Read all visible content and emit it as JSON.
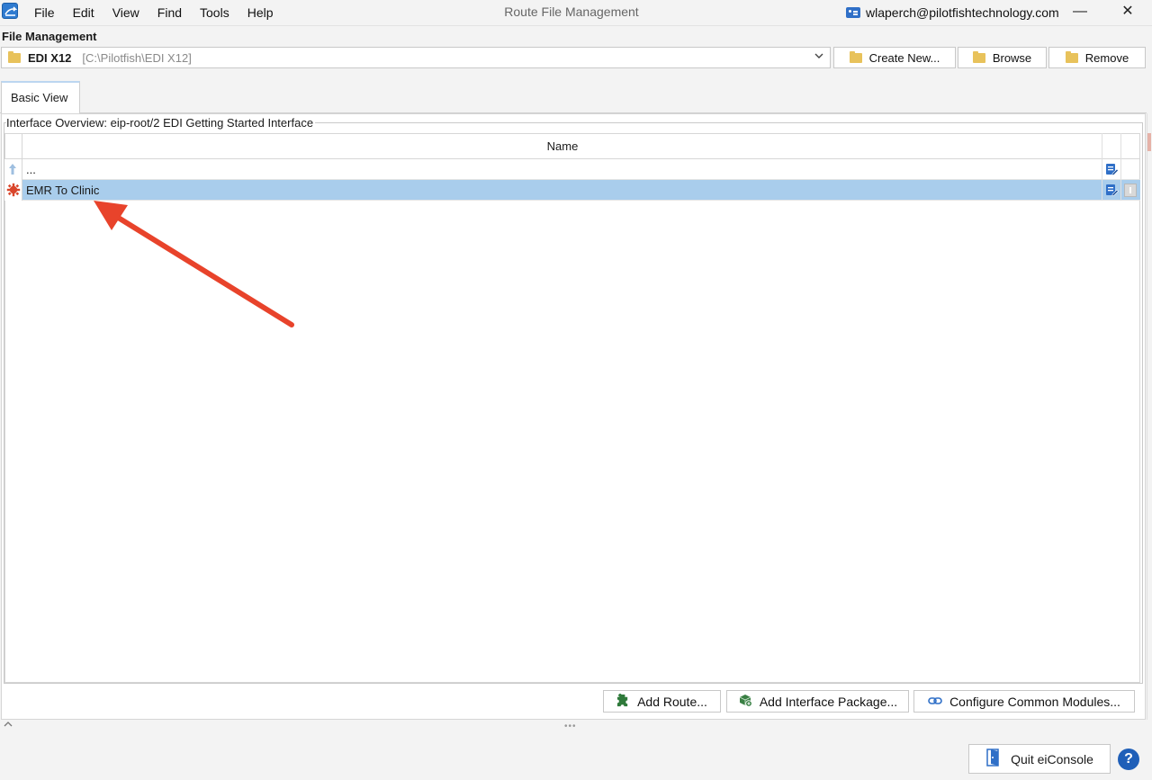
{
  "window": {
    "title": "Route File Management",
    "user": "wlaperch@pilotfishtechnology.com",
    "minimize": "—",
    "close": "✕"
  },
  "menu": [
    "File",
    "Edit",
    "View",
    "Find",
    "Tools",
    "Help"
  ],
  "file_management": {
    "label": "File Management",
    "selected_name": "EDI X12",
    "selected_path": "[C:\\Pilotfish\\EDI X12]",
    "buttons": {
      "create": "Create New...",
      "browse": "Browse",
      "remove": "Remove"
    }
  },
  "tabs": [
    {
      "label": "Basic View",
      "active": true
    }
  ],
  "interface_overview": {
    "title": "Interface Overview: eip-root/2 EDI Getting Started Interface",
    "columns": [
      "Name"
    ],
    "rows": [
      {
        "name": "...",
        "icon": "up-arrow-icon",
        "selected": false
      },
      {
        "name": "EMR To Clinic",
        "icon": "route-icon",
        "selected": true
      }
    ]
  },
  "panel_buttons": {
    "add_route": "Add Route...",
    "add_package": "Add Interface Package...",
    "configure_modules": "Configure Common Modules..."
  },
  "footer": {
    "splitter": "•••",
    "quit": "Quit eiConsole",
    "help": "?"
  },
  "colors": {
    "selection": "#a9cdec",
    "annotation_arrow": "#e8432b",
    "help": "#1f5fb8"
  }
}
